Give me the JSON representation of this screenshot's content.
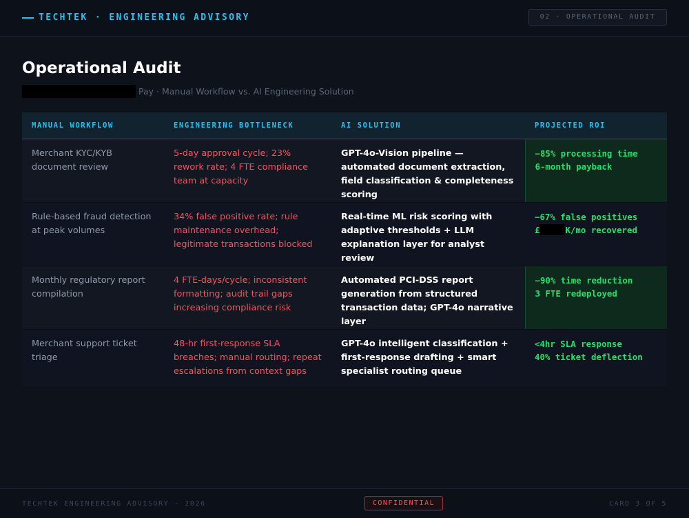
{
  "header": {
    "brand": "TECHTEK · ENGINEERING ADVISORY",
    "section": "02 · OPERATIONAL AUDIT"
  },
  "title": "Operational Audit",
  "subtitle": "Pay · Manual Workflow vs. AI Engineering Solution",
  "table": {
    "columns": [
      "MANUAL WORKFLOW",
      "ENGINEERING BOTTLENECK",
      "AI SOLUTION",
      "PROJECTED ROI"
    ],
    "rows": [
      {
        "workflow": "Merchant KYC/KYB document review",
        "bottleneck": "5-day approval cycle; 23% rework rate; 4 FTE compliance team at capacity",
        "solution": "GPT-4o-Vision pipeline — automated document extraction, field classification & completeness scoring",
        "roi": [
          "−85% processing time",
          "6-month payback"
        ]
      },
      {
        "workflow": "Rule-based fraud detection at peak volumes",
        "bottleneck": "34% false positive rate; rule maintenance overhead; legitimate transactions blocked",
        "solution": "Real-time ML risk scoring with adaptive thresholds + LLM explanation layer for analyst review",
        "roi": [
          "−67% false positives",
          "£",
          "K/mo recovered"
        ]
      },
      {
        "workflow": "Monthly regulatory report compilation",
        "bottleneck": "4 FTE-days/cycle; inconsistent formatting; audit trail gaps increasing compliance risk",
        "solution": "Automated PCI-DSS report generation from structured transaction data; GPT-4o narrative layer",
        "roi": [
          "−90% time reduction",
          "3 FTE redeployed"
        ]
      },
      {
        "workflow": "Merchant support ticket triage",
        "bottleneck": "48-hr first-response SLA breaches; manual routing; repeat escalations from context gaps",
        "solution": "GPT-4o intelligent classification + first-response drafting + smart specialist routing queue",
        "roi": [
          "<4hr SLA response",
          "40% ticket deflection"
        ]
      }
    ]
  },
  "footer": {
    "left": "TECHTEK ENGINEERING ADVISORY · 2026",
    "badge": "CONFIDENTIAL",
    "right": "CARD 3 OF 5"
  },
  "colors": {
    "accent": "#26c0f0",
    "bottleneck": "#ff4d5e",
    "roi": "#22e06b",
    "roi_highlight_bg": "#0d2a1c"
  }
}
